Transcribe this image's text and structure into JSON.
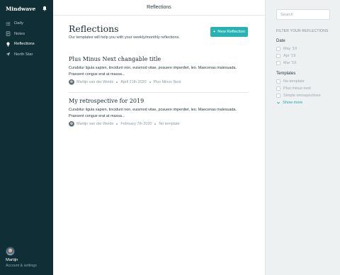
{
  "sidebar": {
    "brand": "Mindwave",
    "items": [
      {
        "label": "Daily",
        "icon": "list-icon"
      },
      {
        "label": "Notes",
        "icon": "notes-icon"
      },
      {
        "label": "Reflections",
        "icon": "lightbulb-icon"
      },
      {
        "label": "North Star",
        "icon": "navigation-icon"
      }
    ],
    "user": {
      "name": "Martijn",
      "subtitle": "Account & settings"
    }
  },
  "header": {
    "title": "Reflections"
  },
  "main": {
    "title": "Reflections",
    "subtitle": "Our templates will help you with your weekly/monthly reflections.",
    "new_button": "New Reflection",
    "reflections": [
      {
        "title": "Plus Minus Next changable title",
        "body": "Curabitur ligula sapien, tincidunt non, euismod vitae, posuere imperdiet, leo. Maecenas malesuada. Praesent congue erat at massa...",
        "author": "Martijn van der Weide",
        "date": "April 21th 2020",
        "template": "Plus Minus Next"
      },
      {
        "title": "My retrospective for 2019",
        "body": "Curabitur ligula sapien, tincidunt non, euismod vitae, posuere imperdiet, leo. Maecenas malesuada. Praesent congue erat at massa...",
        "author": "Martijn van der Weide",
        "date": "February 7th 2020",
        "template": "No template"
      }
    ]
  },
  "filters": {
    "search_placeholder": "Search",
    "heading": "FILTER YOUR REFLECTIONS",
    "date_title": "Date",
    "dates": [
      "May '19",
      "Apr '19",
      "Mar '19"
    ],
    "templates_title": "Templates",
    "templates": [
      "No template",
      "Plus minus next",
      "Simple retrospectives"
    ],
    "show_more": "Show more"
  },
  "colors": {
    "sidebar": "#0f2e36",
    "accent": "#27b3b4",
    "panel": "#eef1f2"
  }
}
